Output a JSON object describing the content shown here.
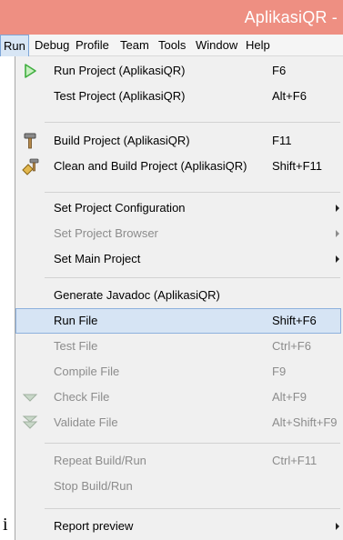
{
  "window": {
    "title": "AplikasiQR -"
  },
  "menubar": {
    "items": [
      {
        "label": "Run"
      },
      {
        "label": "Debug"
      },
      {
        "label": "Profile"
      },
      {
        "label": "Team"
      },
      {
        "label": "Tools"
      },
      {
        "label": "Window"
      },
      {
        "label": "Help"
      }
    ]
  },
  "run_menu": {
    "items": [
      {
        "label": "Run Project (AplikasiQR)",
        "shortcut": "F6",
        "enabled": true,
        "icon": "run-triangle-icon"
      },
      {
        "label": "Test Project (AplikasiQR)",
        "shortcut": "Alt+F6",
        "enabled": true
      },
      {
        "label": "Build Project (AplikasiQR)",
        "shortcut": "F11",
        "enabled": true,
        "icon": "hammer-icon"
      },
      {
        "label": "Clean and Build Project (AplikasiQR)",
        "shortcut": "Shift+F11",
        "enabled": true,
        "icon": "broom-hammer-icon"
      },
      {
        "label": "Set Project Configuration",
        "shortcut": "",
        "enabled": true,
        "submenu": true
      },
      {
        "label": "Set Project Browser",
        "shortcut": "",
        "enabled": false,
        "submenu": true
      },
      {
        "label": "Set Main Project",
        "shortcut": "",
        "enabled": true,
        "submenu": true
      },
      {
        "label": "Generate Javadoc (AplikasiQR)",
        "shortcut": "",
        "enabled": true
      },
      {
        "label": "Run File",
        "shortcut": "Shift+F6",
        "enabled": true,
        "highlighted": true
      },
      {
        "label": "Test File",
        "shortcut": "Ctrl+F6",
        "enabled": false
      },
      {
        "label": "Compile File",
        "shortcut": "F9",
        "enabled": false
      },
      {
        "label": "Check File",
        "shortcut": "Alt+F9",
        "enabled": false,
        "icon": "check-down-icon"
      },
      {
        "label": "Validate File",
        "shortcut": "Alt+Shift+F9",
        "enabled": false,
        "icon": "validate-down-icon"
      },
      {
        "label": "Repeat Build/Run",
        "shortcut": "Ctrl+F11",
        "enabled": false
      },
      {
        "label": "Stop Build/Run",
        "shortcut": "",
        "enabled": false
      },
      {
        "label": "Report preview",
        "shortcut": "",
        "enabled": true,
        "submenu": true
      }
    ]
  },
  "page": {
    "left_glyph": "i"
  },
  "colors": {
    "titlebar": "#ee8f82",
    "menu_bg": "#f0f0f0",
    "highlight": "#d6e4f4",
    "highlight_border": "#8db1dd",
    "disabled_text": "#8c8c8c",
    "run_icon": "#3fae3f"
  }
}
